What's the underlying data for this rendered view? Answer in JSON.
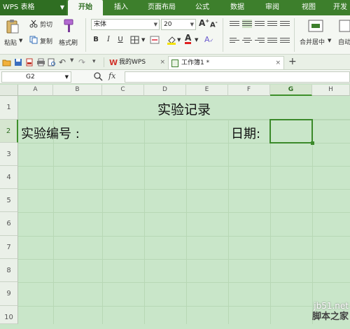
{
  "app": {
    "logo_text": "WPS 表格"
  },
  "menu": {
    "tabs": [
      {
        "label": "开始",
        "active": true
      },
      {
        "label": "插入",
        "active": false
      },
      {
        "label": "页面布局",
        "active": false
      },
      {
        "label": "公式",
        "active": false
      },
      {
        "label": "数据",
        "active": false
      },
      {
        "label": "审阅",
        "active": false
      },
      {
        "label": "视图",
        "active": false
      },
      {
        "label": "开发",
        "active": false
      }
    ]
  },
  "ribbon": {
    "paste_label": "粘贴",
    "cut_label": "剪切",
    "copy_label": "复制",
    "format_painter_label": "格式刷",
    "font_name": "宋体",
    "font_size": "20",
    "bold": "B",
    "italic": "I",
    "underline": "U",
    "merge_center_label": "合并居中",
    "auto_wrap_label": "自动"
  },
  "doc_tabs": [
    {
      "label": "我的WPS",
      "active": false
    },
    {
      "label": "工作簿1 *",
      "active": true
    }
  ],
  "formula_bar": {
    "name_box": "G2",
    "fx": "fx",
    "value": ""
  },
  "grid": {
    "columns": [
      "A",
      "B",
      "C",
      "D",
      "E",
      "F",
      "G",
      "H"
    ],
    "rows": [
      "1",
      "2",
      "3",
      "4",
      "5",
      "6",
      "7",
      "8",
      "9",
      "10"
    ],
    "selected_cell": "G2",
    "cells": {
      "title": "实验记录",
      "a2": "实验编号  :",
      "f2": "日期:"
    }
  },
  "watermark": {
    "line1": "jb51.net",
    "line2": "脚本之家"
  },
  "colors": {
    "menu_bg": "#3d7f2c",
    "grid_bg": "#c9e6c9",
    "selection": "#3b8a2a"
  }
}
